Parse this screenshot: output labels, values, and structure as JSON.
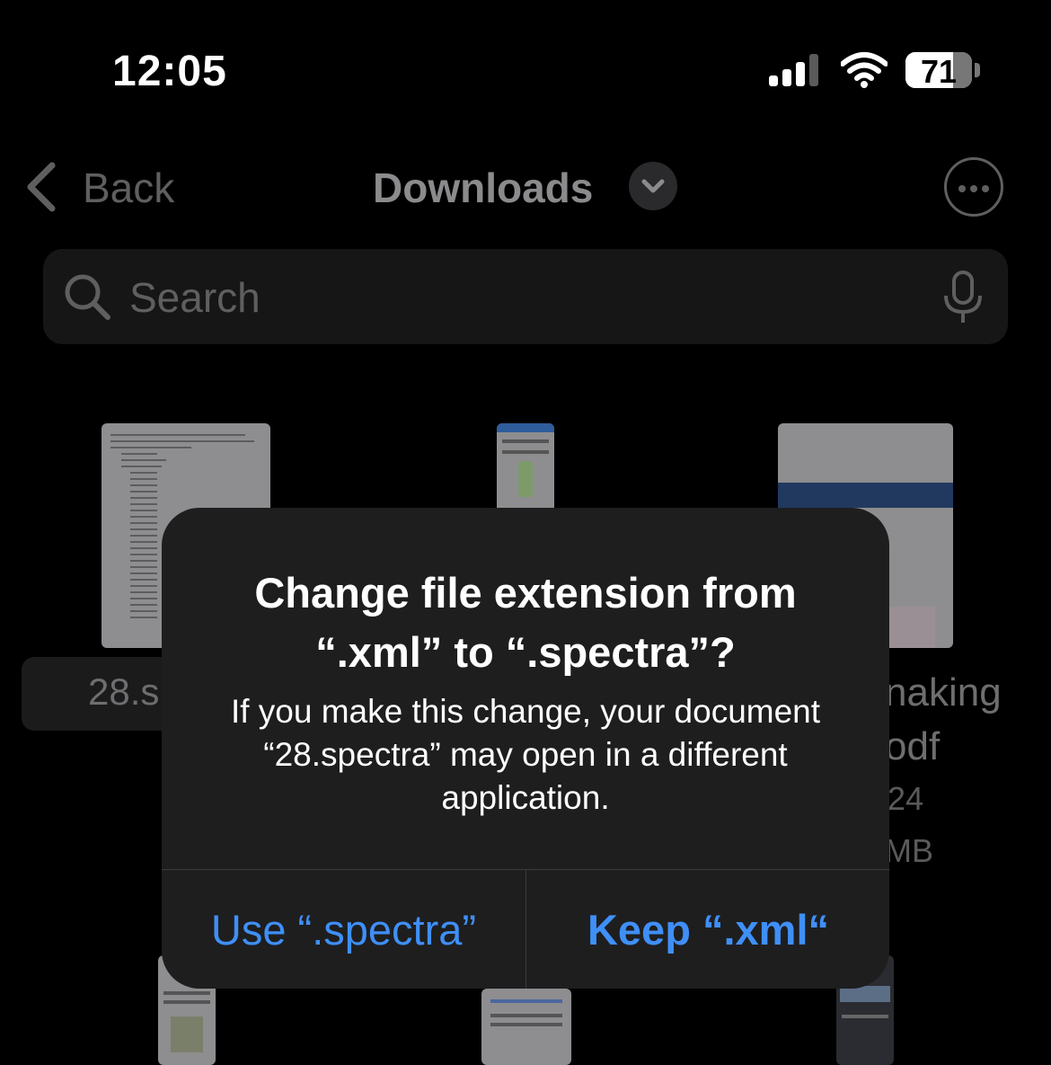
{
  "status_bar": {
    "time": "12:05",
    "battery": "71"
  },
  "nav": {
    "back_label": "Back",
    "title": "Downloads"
  },
  "search": {
    "placeholder": "Search"
  },
  "files": {
    "left_label": "28.s",
    "right_name_1": "naking",
    "right_name_2": "odf",
    "right_meta_1": "24",
    "right_meta_2": "MB"
  },
  "alert": {
    "title": "Change file extension from “.xml” to “.spectra”?",
    "message": "If you make this change, your document “28.spectra” may open in a different application.",
    "use_label": "Use “.spectra”",
    "keep_label": "Keep “.xml“"
  },
  "colors": {
    "accent": "#3f8ff7",
    "alert_bg": "#1e1e1f"
  }
}
